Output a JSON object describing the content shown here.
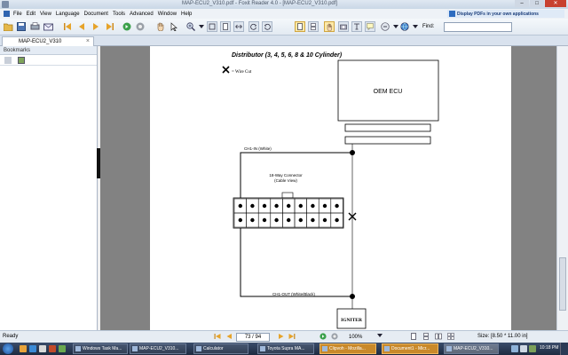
{
  "window": {
    "title": "MAP-ECU2_V310.pdf - Foxit Reader 4.0 - [MAP-ECU2_V310.pdf]"
  },
  "menu": {
    "items": [
      "File",
      "Edit",
      "View",
      "Language",
      "Document",
      "Tools",
      "Advanced",
      "Window",
      "Help"
    ],
    "promo": "Display PDFs in your own applications"
  },
  "toolbar": {
    "find_label": "Find:",
    "find_value": ""
  },
  "document_tab": {
    "label": "MAP-ECU2_V310"
  },
  "bookmarks": {
    "title": "Bookmarks"
  },
  "page": {
    "heading": "Distributor (3, 4, 5, 6, 8 & 10 Cylinder)",
    "wire_cut_label": "= Wire Cut",
    "oem_ecu_label": "OEM ECU",
    "ch1_in_label": "CH1-IN (White)",
    "connector_label_line1": "18-Way Connector",
    "connector_label_line2": "(Cable View)",
    "ch1_out_label": "CH1-OUT (White/Black)",
    "igniter_label": "IGNITER"
  },
  "status": {
    "ready": "Ready",
    "page_indicator": "73 / 94",
    "zoom": "100%",
    "size": "Size: [8.50 * 11.00 in]"
  },
  "taskbar": {
    "items": [
      {
        "label": "Windows Task Ma...",
        "state": "normal"
      },
      {
        "label": "MAP-ECU2_V310...",
        "state": "normal"
      },
      {
        "label": "Calculator",
        "state": "normal"
      },
      {
        "label": "Toyota Supra MA...",
        "state": "normal"
      },
      {
        "label": "Clipvoh - Mozilla...",
        "state": "warn"
      },
      {
        "label": "Document1 - Micr...",
        "state": "warn"
      },
      {
        "label": "MAP-ECU2_V310...",
        "state": "active"
      }
    ],
    "clock": "10:18 PM"
  },
  "colors": {
    "doc_background": "#828282",
    "close_button": "#c8412f",
    "taskbar": "#1e2b40"
  }
}
